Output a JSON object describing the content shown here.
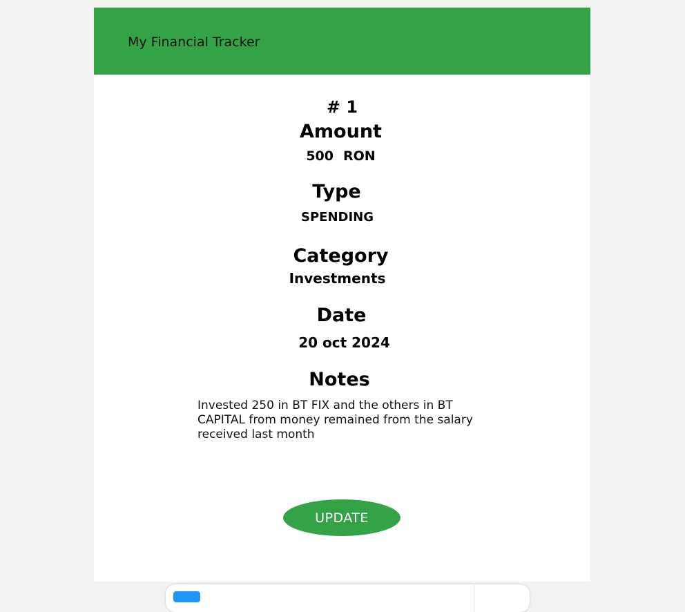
{
  "header": {
    "title": "My Financial Tracker"
  },
  "entry": {
    "number": "# 1",
    "amount_label": "Amount",
    "amount": "500",
    "currency": "RON",
    "type_label": "Type",
    "type": "SPENDING",
    "category_label": "Category",
    "category": "Investments",
    "date_label": "Date",
    "date": "20 oct 2024",
    "notes_label": "Notes",
    "notes": "Invested 250 in BT FIX and the others in BT CAPITAL from money remained from the salary received last month"
  },
  "actions": {
    "update_label": "UPDATE"
  },
  "colors": {
    "accent": "#34a347",
    "page_background": "#f2f2f2",
    "card_background": "#ffffff",
    "bottom_bar_icon": "#2196f3"
  }
}
